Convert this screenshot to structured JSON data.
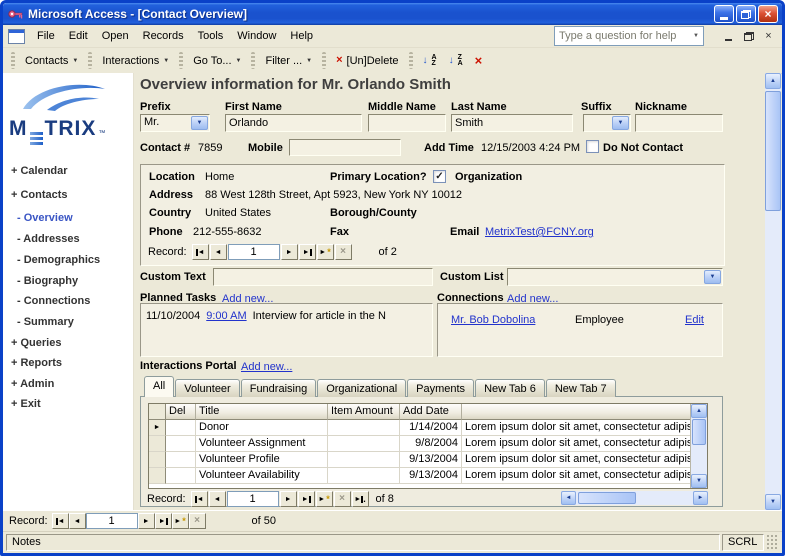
{
  "window": {
    "title": "Microsoft Access - [Contact Overview]"
  },
  "menubar": {
    "items": [
      "File",
      "Edit",
      "Open",
      "Records",
      "Tools",
      "Window",
      "Help"
    ],
    "help_placeholder": "Type a question for help"
  },
  "toolbar": {
    "buttons": [
      "Contacts",
      "Interactions",
      "Go To...",
      "Filter ...",
      "[Un]Delete"
    ]
  },
  "sidebar": {
    "logo_m": "M",
    "logo_rest": "TRIX",
    "logo_tm": "™",
    "items": [
      "+ Calendar",
      "+ Contacts",
      "- Overview",
      "- Addresses",
      "- Demographics",
      "- Biography",
      "- Connections",
      "- Summary",
      "+ Queries",
      "+ Reports",
      "+ Admin",
      "+ Exit"
    ]
  },
  "form": {
    "title": "Overview information for Mr. Orlando Smith",
    "name_fields": {
      "prefix_label": "Prefix",
      "prefix_value": "Mr.",
      "first_label": "First Name",
      "first_value": "Orlando",
      "middle_label": "Middle Name",
      "middle_value": "",
      "last_label": "Last Name",
      "last_value": "Smith",
      "suffix_label": "Suffix",
      "suffix_value": "",
      "nickname_label": "Nickname",
      "nickname_value": ""
    },
    "contact_row": {
      "contact_label": "Contact #",
      "contact_value": "7859",
      "mobile_label": "Mobile",
      "mobile_value": "",
      "addtime_label": "Add Time",
      "addtime_value": "12/15/2003 4:24 PM",
      "dnc_label": "Do Not Contact"
    },
    "location": {
      "location_label": "Location",
      "location_value": "Home",
      "primary_label": "Primary Location?",
      "organization_label": "Organization",
      "address_label": "Address",
      "address_value": "88 West 128th Street, Apt 5923, New York NY 10012",
      "country_label": "Country",
      "country_value": "United States",
      "borough_label": "Borough/County",
      "phone_label": "Phone",
      "phone_value": "212-555-8632",
      "fax_label": "Fax",
      "email_label": "Email",
      "email_value": "MetrixTest@FCNY.org",
      "nav": {
        "label": "Record:",
        "value": "1",
        "of": "of 2"
      }
    },
    "custom": {
      "text_label": "Custom Text",
      "text_value": "",
      "list_label": "Custom List",
      "list_value": ""
    },
    "planned_tasks": {
      "label": "Planned Tasks",
      "add_new": "Add new...",
      "row": {
        "date": "11/10/2004",
        "time": "9:00 AM",
        "desc": "Interview for article in the N"
      }
    },
    "connections": {
      "label": "Connections",
      "add_new": "Add new...",
      "row": {
        "name": "Mr. Bob Dobolina",
        "type": "Employee",
        "edit": "Edit"
      }
    }
  },
  "portal": {
    "label": "Interactions Portal",
    "add_new": "Add new...",
    "tabs": [
      "All",
      "Volunteer",
      "Fundraising",
      "Organizational",
      "Payments",
      "New Tab 6",
      "New Tab 7"
    ],
    "columns": {
      "del": "Del",
      "title": "Title",
      "amount": "Item Amount",
      "date": "Add Date"
    },
    "rows": [
      {
        "title": "Donor",
        "amount": "",
        "date": "1/14/2004",
        "notes": "Lorem ipsum dolor sit amet, consectetur adipisicing elit"
      },
      {
        "title": "Volunteer Assignment",
        "amount": "",
        "date": "9/8/2004",
        "notes": "Lorem ipsum dolor sit amet, consectetur adipisicing elit"
      },
      {
        "title": "Volunteer Profile",
        "amount": "",
        "date": "9/13/2004",
        "notes": "Lorem ipsum dolor sit amet, consectetur adipisicing elit"
      },
      {
        "title": "Volunteer Availability",
        "amount": "",
        "date": "9/13/2004",
        "notes": "Lorem ipsum dolor sit amet, consectetur adipisicing elit"
      }
    ],
    "nav": {
      "label": "Record:",
      "value": "1",
      "of": "of 8"
    }
  },
  "bottom_nav": {
    "label": "Record:",
    "value": "1",
    "of": "of 50"
  },
  "statusbar": {
    "left": "Notes",
    "right": "SCRL"
  },
  "icons": {
    "prev": "◄",
    "next": "►",
    "up": "▲",
    "down": "▼",
    "dropdown": "▼",
    "check": "✓",
    "x": "×",
    "asterisk": "*",
    "arrow_down": "↓",
    "sort_a": "A",
    "sort_z": "Z",
    "dot": "."
  }
}
